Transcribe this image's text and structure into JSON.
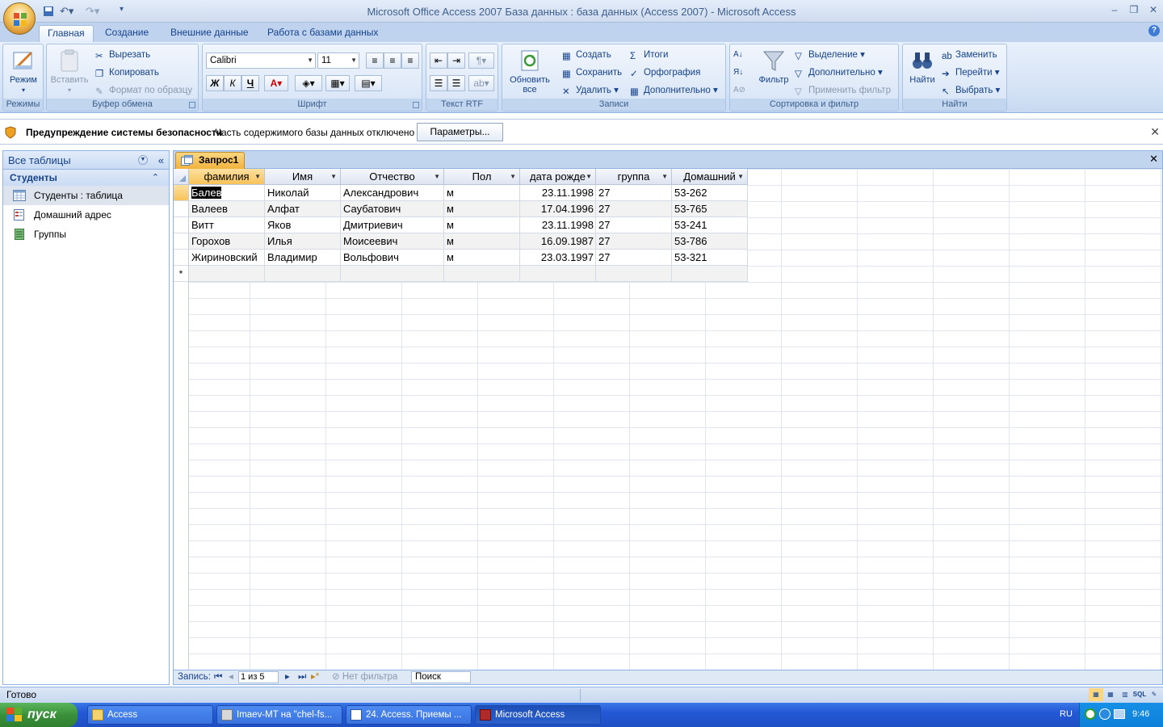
{
  "titlebar": {
    "title": "Microsoft Office Access 2007 База данных : база данных (Access 2007) - Microsoft Access"
  },
  "tabs": [
    {
      "label": "Главная",
      "active": true
    },
    {
      "label": "Создание"
    },
    {
      "label": "Внешние данные"
    },
    {
      "label": "Работа с базами данных"
    }
  ],
  "ribbon": {
    "views": {
      "button": "Режим",
      "group": "Режимы"
    },
    "clipboard": {
      "paste": "Вставить",
      "cut": "Вырезать",
      "copy": "Копировать",
      "format_painter": "Формат по образцу",
      "group": "Буфер обмена"
    },
    "font": {
      "font_name": "Calibri",
      "font_size": "11",
      "bold": "Ж",
      "italic": "К",
      "underline": "Ч",
      "group": "Шрифт"
    },
    "rtf": {
      "group": "Текст RTF"
    },
    "records": {
      "refresh": "Обновить все",
      "new": "Создать",
      "save": "Сохранить",
      "delete": "Удалить",
      "totals": "Итоги",
      "spelling": "Орфография",
      "more": "Дополнительно",
      "group": "Записи"
    },
    "sort_filter": {
      "filter": "Фильтр",
      "selection": "Выделение",
      "advanced": "Дополнительно",
      "toggle_filter": "Применить фильтр",
      "group": "Сортировка и фильтр"
    },
    "find": {
      "find": "Найти",
      "replace": "Заменить",
      "goto": "Перейти",
      "select": "Выбрать",
      "group": "Найти"
    }
  },
  "security": {
    "title": "Предупреждение системы безопасности",
    "message": "Часть содержимого базы данных отключено",
    "button": "Параметры..."
  },
  "nav": {
    "header": "Все таблицы",
    "group": "Студенты",
    "items": [
      {
        "label": "Студенты : таблица",
        "selected": true
      },
      {
        "label": "Домашний адрес"
      },
      {
        "label": "Группы"
      }
    ]
  },
  "document": {
    "tab": "Запрос1",
    "columns": [
      "фамилия",
      "Имя",
      "Отчество",
      "Пол",
      "дата рожде",
      "группа",
      "Домашний"
    ],
    "rows": [
      [
        "Балев",
        "Николай",
        "Александрович",
        "м",
        "23.11.1998",
        "27",
        "53-262"
      ],
      [
        "Валеев",
        "Алфат",
        "Саубатович",
        "м",
        "17.04.1996",
        "27",
        "53-765"
      ],
      [
        "Витт",
        "Яков",
        "Дмитриевич",
        "м",
        "23.11.1998",
        "27",
        "53-241"
      ],
      [
        "Горохов",
        "Илья",
        "Моисеевич",
        "м",
        "16.09.1987",
        "27",
        "53-786"
      ],
      [
        "Жириновский",
        "Владимир",
        "Вольфович",
        "м",
        "23.03.1997",
        "27",
        "53-321"
      ]
    ],
    "new_row_marker": "*"
  },
  "record_nav": {
    "label": "Запись:",
    "position": "1 из 5",
    "filter": "Нет фильтра",
    "search": "Поиск"
  },
  "status": {
    "text": "Готово"
  },
  "taskbar": {
    "start": "пуск",
    "tasks": [
      {
        "label": "Access"
      },
      {
        "label": "Imaev-MT на \"chel-fs..."
      },
      {
        "label": "24. Access. Приемы ..."
      },
      {
        "label": "Microsoft Access",
        "active": true
      }
    ],
    "lang": "RU",
    "clock": "9:46"
  }
}
